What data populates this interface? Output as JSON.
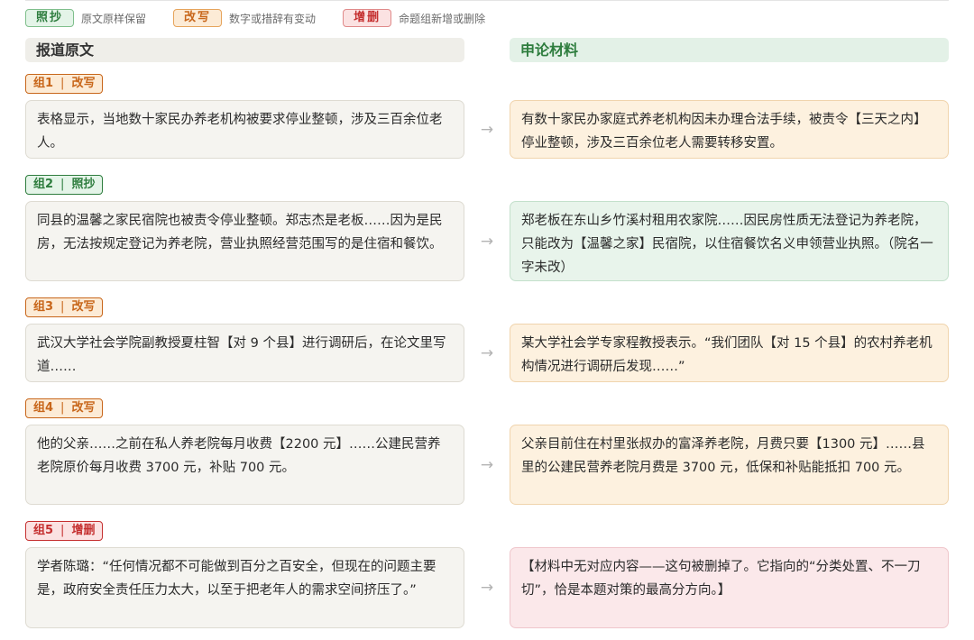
{
  "legend": [
    {
      "badge": "照抄",
      "desc": "原文原样保留",
      "kind": "copy"
    },
    {
      "badge": "改写",
      "desc": "数字或措辞有变动",
      "kind": "rewrite"
    },
    {
      "badge": "增删",
      "desc": "命题组新增或删除",
      "kind": "delete"
    }
  ],
  "columns": {
    "left": "报道原文",
    "right": "申论材料"
  },
  "arrow": "→",
  "groups": [
    {
      "group": "组1",
      "label": "改写",
      "kind": "rewrite",
      "original": "表格显示，当地数十家民办养老机构被要求停业整顿，涉及三百余位老人。",
      "material": "有数十家民办家庭式养老机构因未办理合法手续，被责令【三天之内】停业整顿，涉及三百余位老人需要转移安置。"
    },
    {
      "group": "组2",
      "label": "照抄",
      "kind": "copy",
      "original": "同县的温馨之家民宿院也被责令停业整顿。郑志杰是老板……因为是民房，无法按规定登记为养老院，营业执照经营范围写的是住宿和餐饮。",
      "material": "郑老板在东山乡竹溪村租用农家院……因民房性质无法登记为养老院，只能改为【温馨之家】民宿院，以住宿餐饮名义申领营业执照。（院名一字未改）"
    },
    {
      "group": "组3",
      "label": "改写",
      "kind": "rewrite",
      "original": "武汉大学社会学院副教授夏柱智【对 9 个县】进行调研后，在论文里写道……",
      "material": "某大学社会学专家程教授表示。“我们团队【对 15 个县】的农村养老机构情况进行调研后发现……”"
    },
    {
      "group": "组4",
      "label": "改写",
      "kind": "rewrite",
      "original": "他的父亲……之前在私人养老院每月收费【2200 元】……公建民营养老院原价每月收费 3700 元，补贴 700 元。",
      "material": "父亲目前住在村里张叔办的富泽养老院，月费只要【1300 元】……县里的公建民营养老院月费是 3700 元，低保和补贴能抵扣 700 元。"
    },
    {
      "group": "组5",
      "label": "增删",
      "kind": "delete",
      "original": "学者陈璐：“任何情况都不可能做到百分之百安全，但现在的问题主要是，政府安全责任压力太大，以至于把老年人的需求空间挤压了。”",
      "material": "【材料中无对应内容——这句被删掉了。它指向的“分类处置、不一刀切”，恰是本题对策的最高分方向。】"
    }
  ]
}
